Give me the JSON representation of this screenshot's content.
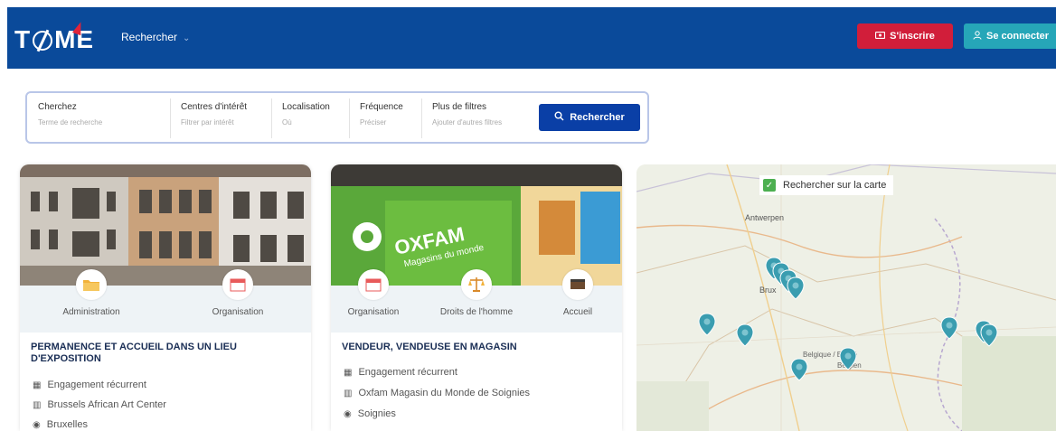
{
  "header": {
    "logo_text_left": "T",
    "logo_text_right": "ME",
    "nav_search_label": "Rechercher",
    "register_label": "S'inscrire",
    "login_label": "Se connecter",
    "colors": {
      "nav_bg": "#0a4a9a",
      "register_bg": "#d11e3a",
      "login_bg": "#26a6b8"
    }
  },
  "search": {
    "fields": [
      {
        "label": "Cherchez",
        "placeholder": "Terme de recherche"
      },
      {
        "label": "Centres d'intérêt",
        "placeholder": "Filtrer par intérêt"
      },
      {
        "label": "Localisation",
        "placeholder": "Où"
      },
      {
        "label": "Fréquence",
        "placeholder": "Préciser"
      },
      {
        "label": "Plus de filtres",
        "placeholder": "Ajouter d'autres filtres"
      }
    ],
    "button_label": "Rechercher"
  },
  "cards": [
    {
      "categories": [
        {
          "label": "Administration",
          "icon": "folder-icon"
        },
        {
          "label": "Organisation",
          "icon": "calendar-icon"
        }
      ],
      "title": "PERMANENCE ET ACCUEIL DANS UN LIEU D'EXPOSITION",
      "frequency": "Engagement récurrent",
      "organization": "Brussels African Art Center",
      "location": "Bruxelles"
    },
    {
      "image_text_line1": "OXFAM",
      "image_text_line2": "Magasins du monde",
      "categories": [
        {
          "label": "Organisation",
          "icon": "calendar-icon"
        },
        {
          "label": "Droits de l'homme",
          "icon": "scales-icon"
        },
        {
          "label": "Accueil",
          "icon": "desk-icon"
        }
      ],
      "title": "VENDEUR, VENDEUSE EN MAGASIN",
      "frequency": "Engagement récurrent",
      "organization": "Oxfam Magasin du Monde de Soignies",
      "location": "Soignies"
    }
  ],
  "map": {
    "checkbox_label": "Rechercher sur la carte",
    "place_labels": [
      "Antwerpen",
      "Brux",
      "Belgique / België",
      "Belgien"
    ],
    "pin_count": 11
  }
}
